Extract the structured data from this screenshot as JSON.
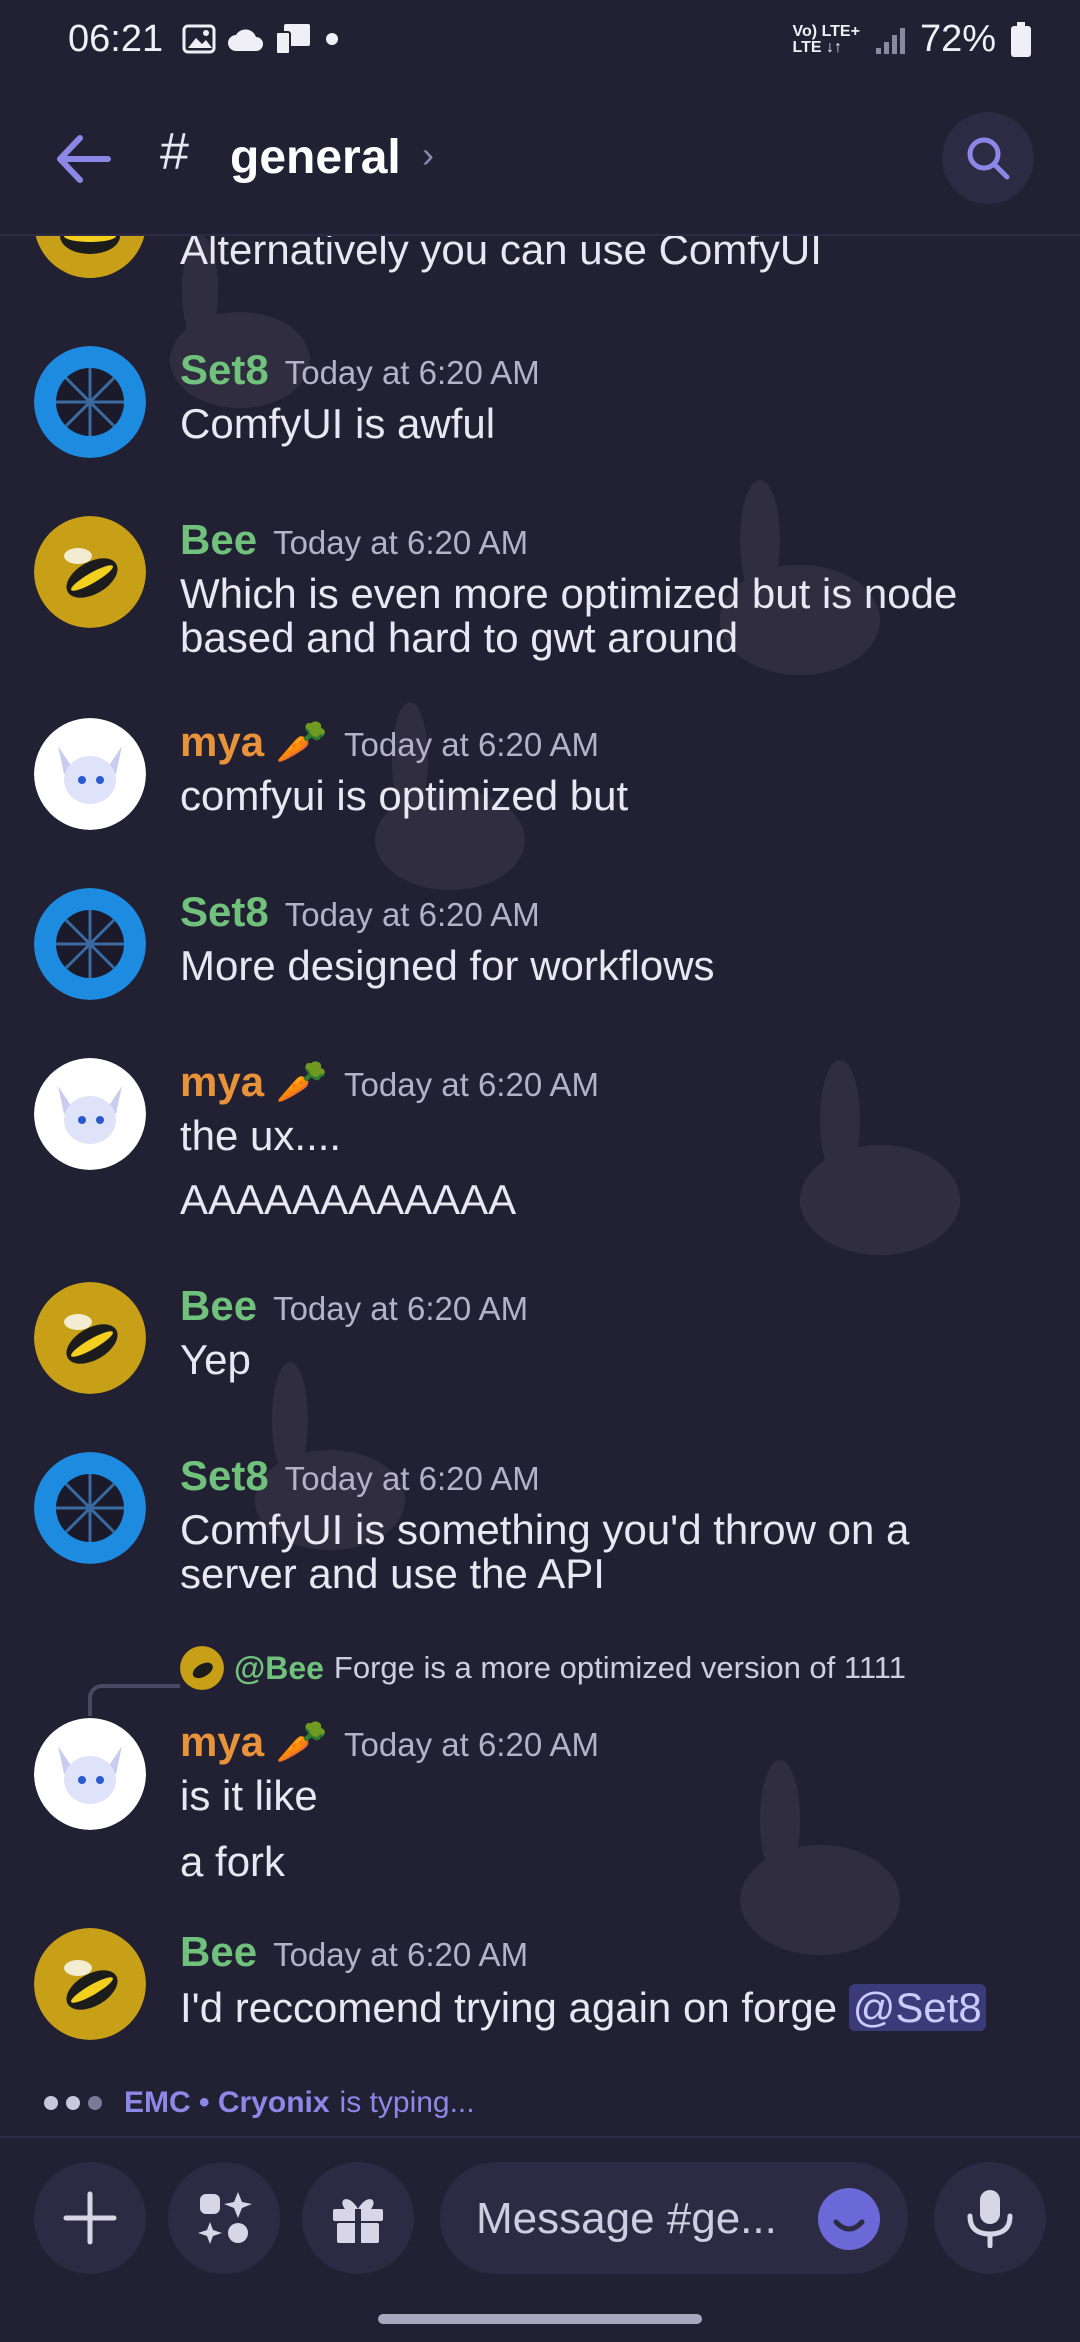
{
  "status_bar": {
    "time": "06:21",
    "battery": "72%",
    "net_top": "Vo) LTE+",
    "net_bottom": "LTE ↓↑"
  },
  "header": {
    "channel_hash": "#",
    "channel_name": "general",
    "chevron": "›"
  },
  "messages": [
    {
      "author": "",
      "time": "",
      "lines": [
        "Alternatively you can use ComfyUI"
      ]
    },
    {
      "author": "Set8",
      "time": "Today at 6:20 AM",
      "lines": [
        "ComfyUI is awful"
      ]
    },
    {
      "author": "Bee",
      "time": "Today at 6:20 AM",
      "lines": [
        "Which is even more optimized but is node",
        "based and hard to gwt around"
      ]
    },
    {
      "author": "mya 🥕",
      "time": "Today at 6:20 AM",
      "lines": [
        "comfyui is optimized but"
      ]
    },
    {
      "author": "Set8",
      "time": "Today at 6:20 AM",
      "lines": [
        "More designed for workflows"
      ]
    },
    {
      "author": "mya 🥕",
      "time": "Today at 6:20 AM",
      "lines": [
        "the ux....",
        "AAAAAAAAAAAA"
      ]
    },
    {
      "author": "Bee",
      "time": "Today at 6:20 AM",
      "lines": [
        "Yep"
      ]
    },
    {
      "author": "Set8",
      "time": "Today at 6:20 AM",
      "lines": [
        "ComfyUI is something you'd throw on a",
        "server and use the API"
      ]
    },
    {
      "author": "mya 🥕",
      "time": "Today at 6:20 AM",
      "reply_author": "@Bee",
      "reply_text": "Forge is a more optimized version of 1111",
      "lines": [
        "is it like",
        "a fork"
      ]
    },
    {
      "author": "Bee",
      "time": "Today at 6:20 AM",
      "lines": [
        "I'd reccomend trying again on forge "
      ],
      "mention": "@Set8"
    }
  ],
  "typing": {
    "names": "EMC • Cryonix",
    "suffix": "is typing..."
  },
  "composer": {
    "placeholder": "Message #ge..."
  },
  "colors": {
    "background": "#222033",
    "username_green": "#6fc17b",
    "username_orange": "#e8923a",
    "accent": "#6b69d8"
  }
}
